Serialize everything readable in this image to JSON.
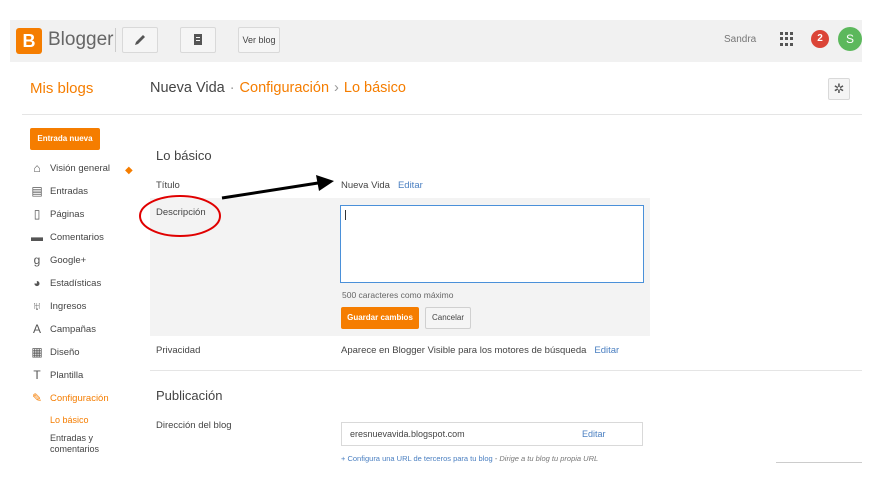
{
  "topbar": {
    "brand": "Blogger",
    "logo_letter": "B",
    "view_blog": "Ver blog",
    "user": "Sandra",
    "notifications": "2",
    "avatar_letter": "S"
  },
  "header": {
    "mis_blogs": "Mis blogs",
    "blog_name": "Nueva Vida",
    "sep": "·",
    "section": "Configuración",
    "arrow": "›",
    "page": "Lo básico"
  },
  "sidebar": {
    "new_post": "Entrada nueva",
    "items": [
      {
        "label": "Visión general",
        "icon": "home-icon",
        "glyph": "⌂"
      },
      {
        "label": "Entradas",
        "icon": "posts-icon",
        "glyph": "▤"
      },
      {
        "label": "Páginas",
        "icon": "pages-icon",
        "glyph": "▯"
      },
      {
        "label": "Comentarios",
        "icon": "comments-icon",
        "glyph": "▬"
      },
      {
        "label": "Google+",
        "icon": "google-plus-icon",
        "glyph": "g"
      },
      {
        "label": "Estadísticas",
        "icon": "stats-icon",
        "glyph": "◕"
      },
      {
        "label": "Ingresos",
        "icon": "trophy-icon",
        "glyph": "♅"
      },
      {
        "label": "Campañas",
        "icon": "campaigns-icon",
        "glyph": "A"
      },
      {
        "label": "Diseño",
        "icon": "layout-icon",
        "glyph": "▦"
      },
      {
        "label": "Plantilla",
        "icon": "template-icon",
        "glyph": "T"
      },
      {
        "label": "Configuración",
        "icon": "wrench-icon",
        "glyph": "✎"
      }
    ],
    "sub": [
      "Lo básico",
      "Entradas y comentarios"
    ]
  },
  "main": {
    "basics_title": "Lo básico",
    "title_label": "Título",
    "title_value": "Nueva Vida",
    "edit": "Editar",
    "description_label": "Descripción",
    "hint": "500 caracteres como máximo",
    "save": "Guardar cambios",
    "cancel": "Cancelar",
    "privacy_label": "Privacidad",
    "privacy_value": "Aparece en Blogger Visible para los motores de búsqueda",
    "publication_title": "Publicación",
    "address_label": "Dirección del blog",
    "address_value": "eresnuevavida.blogspot.com",
    "address_note_link": "+ Configura una URL de terceros para tu blog",
    "address_note_rest": " - Dirige a tu blog tu propia URL"
  },
  "colors": {
    "accent": "#f57d00",
    "link": "#4a7fc1",
    "annotation_circle": "#e00000",
    "annotation_arrow": "#000000"
  }
}
